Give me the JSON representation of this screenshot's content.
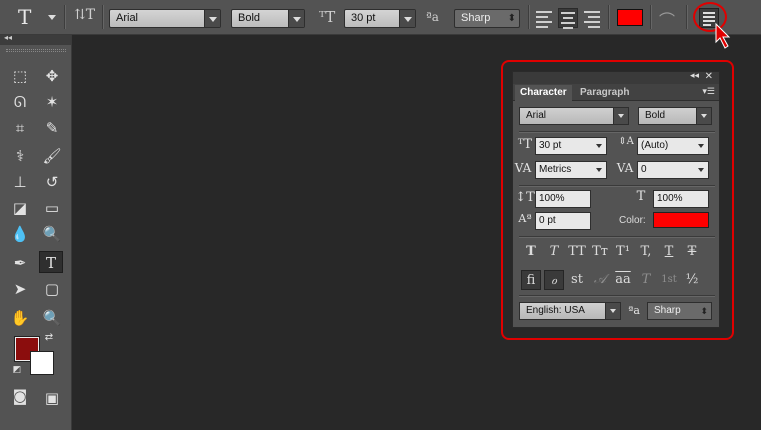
{
  "options_bar": {
    "tool_preset_icon": "T",
    "orientation_icon": "⇅T",
    "font_family": "Arial",
    "font_style": "Bold",
    "font_size": "30 pt",
    "aa_icon": "ªa",
    "anti_alias": "Sharp",
    "text_color": "#ff0000"
  },
  "toolbox": {
    "collapse_icon": "◂◂",
    "type_tool_label": "T"
  },
  "character_panel": {
    "tabs": [
      "Character",
      "Paragraph"
    ],
    "font_family": "Arial",
    "font_style": "Bold",
    "font_size": "30 pt",
    "leading": "(Auto)",
    "kerning": "Metrics",
    "tracking": "0",
    "vertical_scale": "100%",
    "horizontal_scale": "100%",
    "baseline_shift": "0 pt",
    "color_label": "Color:",
    "color": "#ff0000",
    "style_buttons": [
      "T",
      "T",
      "TT",
      "Tт",
      "T¹",
      "T,",
      "T",
      "Ŧ"
    ],
    "opentype_buttons": [
      "ﬁ",
      "ℴ",
      "st",
      "𝒜",
      "aa",
      "T",
      "1st",
      "½"
    ],
    "language": "English: USA",
    "aa_icon": "ªa",
    "anti_alias": "Sharp"
  }
}
